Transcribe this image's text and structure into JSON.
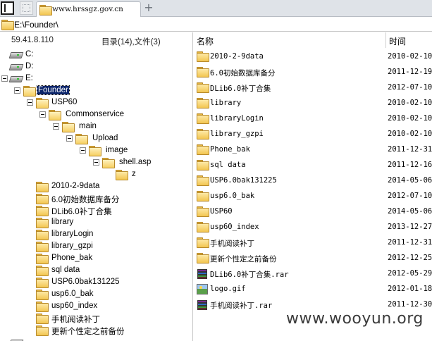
{
  "tab": {
    "url": "www.hrssgz.gov.cn",
    "new_tab_symbol": "+"
  },
  "address": {
    "path": "E:\\Founder\\"
  },
  "left": {
    "ip": "59.41.8.110",
    "counts": "目录(14),文件(3)",
    "drives": [
      {
        "label": "C:"
      },
      {
        "label": "D:"
      },
      {
        "label": "E:"
      }
    ],
    "tree": [
      {
        "label": "Founder",
        "selected": true
      },
      {
        "label": "USP60"
      },
      {
        "label": "Commonservice"
      },
      {
        "label": "main"
      },
      {
        "label": "Upload"
      },
      {
        "label": "image"
      },
      {
        "label": "shell.asp"
      },
      {
        "label": "z"
      }
    ],
    "folders": [
      {
        "label": "2010-2-9data"
      },
      {
        "label": "6.0初始数据库备分"
      },
      {
        "label": "DLib6.0补丁合集"
      },
      {
        "label": "library"
      },
      {
        "label": "libraryLogin"
      },
      {
        "label": "library_gzpi"
      },
      {
        "label": "Phone_bak"
      },
      {
        "label": "sql data"
      },
      {
        "label": "USP6.0bak131225"
      },
      {
        "label": "usp6.0_bak"
      },
      {
        "label": "usp60_index"
      },
      {
        "label": "手机阅读补丁"
      },
      {
        "label": "更新个性定之前备份"
      }
    ]
  },
  "right": {
    "header": {
      "name": "名称",
      "time": "时间"
    },
    "files": [
      {
        "name": "2010-2-9data",
        "date": "2010-02-10",
        "icon": "folder-icon"
      },
      {
        "name": "6.0初始数据库备分",
        "date": "2011-12-19",
        "icon": "folder-icon"
      },
      {
        "name": "DLib6.0补丁合集",
        "date": "2012-07-10",
        "icon": "folder-icon"
      },
      {
        "name": "library",
        "date": "2010-02-10",
        "icon": "folder-icon"
      },
      {
        "name": "libraryLogin",
        "date": "2010-02-10",
        "icon": "folder-icon"
      },
      {
        "name": "library_gzpi",
        "date": "2010-02-10",
        "icon": "folder-icon"
      },
      {
        "name": "Phone_bak",
        "date": "2011-12-31",
        "icon": "folder-icon"
      },
      {
        "name": "sql data",
        "date": "2011-12-16",
        "icon": "folder-icon"
      },
      {
        "name": "USP6.0bak131225",
        "date": "2014-05-06",
        "icon": "folder-icon"
      },
      {
        "name": "usp6.0_bak",
        "date": "2012-07-10",
        "icon": "folder-icon"
      },
      {
        "name": "USP60",
        "date": "2014-05-06",
        "icon": "folder-icon"
      },
      {
        "name": "usp60_index",
        "date": "2013-12-27",
        "icon": "folder-icon"
      },
      {
        "name": "手机阅读补丁",
        "date": "2011-12-31",
        "icon": "folder-icon"
      },
      {
        "name": "更新个性定之前备份",
        "date": "2012-12-25",
        "icon": "folder-icon"
      },
      {
        "name": "DLib6.0补丁合集.rar",
        "date": "2012-05-29",
        "icon": "rar-icon"
      },
      {
        "name": "logo.gif",
        "date": "2012-01-18",
        "icon": "image-icon"
      },
      {
        "name": "手机阅读补丁.rar",
        "date": "2011-12-30",
        "icon": "rar-icon"
      }
    ]
  },
  "watermark": "www.wooyun.org"
}
